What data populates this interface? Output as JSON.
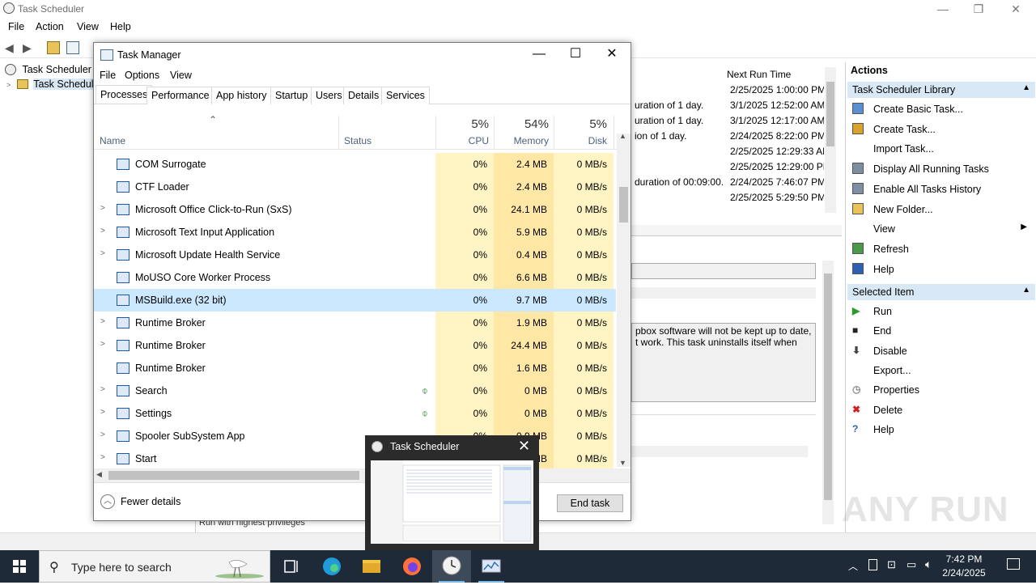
{
  "ts": {
    "title": "Task Scheduler",
    "menu": [
      "File",
      "Action",
      "View",
      "Help"
    ],
    "tree": {
      "root": "Task Scheduler (L",
      "child": "Task Schedule"
    },
    "next_run_header": "Next Run Time",
    "task_lines": [
      {
        "trigger": "",
        "next": "2/25/2025 1:00:00 PM"
      },
      {
        "trigger": "uration of 1 day.",
        "next": "3/1/2025 12:52:00 AM"
      },
      {
        "trigger": "uration of 1 day.",
        "next": "3/1/2025 12:17:00 AM"
      },
      {
        "trigger": "ion of 1 day.",
        "next": "2/24/2025 8:22:00 PM"
      },
      {
        "trigger": "",
        "next": "2/25/2025 12:29:33 AM"
      },
      {
        "trigger": "",
        "next": "2/25/2025 12:29:00 PM"
      },
      {
        "trigger": "duration of 00:09:00.",
        "next": "2/24/2025 7:46:07 PM"
      },
      {
        "trigger": "",
        "next": "2/25/2025 5:29:50 PM"
      }
    ],
    "desc_line1": "pbox software will not be kept up to date,",
    "desc_line2": "t work. This task uninstalls itself when",
    "bottom_text": "Run with highest privileges",
    "actions": {
      "header": "Actions",
      "section1": "Task Scheduler Library",
      "section1_items": [
        "Create Basic Task...",
        "Create Task...",
        "Import Task...",
        "Display All Running Tasks",
        "Enable All Tasks History",
        "New Folder...",
        "View",
        "Refresh",
        "Help"
      ],
      "section2": "Selected Item",
      "section2_items": [
        "Run",
        "End",
        "Disable",
        "Export...",
        "Properties",
        "Delete",
        "Help"
      ]
    }
  },
  "tm": {
    "title": "Task Manager",
    "menu": [
      "File",
      "Options",
      "View"
    ],
    "tabs": [
      "Processes",
      "Performance",
      "App history",
      "Startup",
      "Users",
      "Details",
      "Services"
    ],
    "columns": {
      "name": "Name",
      "status": "Status",
      "cpu_pct": "5%",
      "cpu": "CPU",
      "mem_pct": "54%",
      "mem": "Memory",
      "disk_pct": "5%",
      "disk": "Disk"
    },
    "rows": [
      {
        "name": "COM Surrogate",
        "expand": false,
        "leaf": false,
        "cpu": "0%",
        "mem": "2.4 MB",
        "disk": "0 MB/s"
      },
      {
        "name": "CTF Loader",
        "expand": false,
        "leaf": false,
        "cpu": "0%",
        "mem": "2.4 MB",
        "disk": "0 MB/s"
      },
      {
        "name": "Microsoft Office Click-to-Run (SxS)",
        "expand": true,
        "leaf": false,
        "cpu": "0%",
        "mem": "24.1 MB",
        "disk": "0 MB/s"
      },
      {
        "name": "Microsoft Text Input Application",
        "expand": true,
        "leaf": false,
        "cpu": "0%",
        "mem": "5.9 MB",
        "disk": "0 MB/s"
      },
      {
        "name": "Microsoft Update Health Service",
        "expand": true,
        "leaf": false,
        "cpu": "0%",
        "mem": "0.4 MB",
        "disk": "0 MB/s"
      },
      {
        "name": "MoUSO Core Worker Process",
        "expand": false,
        "leaf": false,
        "cpu": "0%",
        "mem": "6.6 MB",
        "disk": "0 MB/s"
      },
      {
        "name": "MSBuild.exe (32 bit)",
        "expand": false,
        "leaf": false,
        "cpu": "0%",
        "mem": "9.7 MB",
        "disk": "0 MB/s",
        "selected": true
      },
      {
        "name": "Runtime Broker",
        "expand": true,
        "leaf": false,
        "cpu": "0%",
        "mem": "1.9 MB",
        "disk": "0 MB/s"
      },
      {
        "name": "Runtime Broker",
        "expand": true,
        "leaf": false,
        "cpu": "0%",
        "mem": "24.4 MB",
        "disk": "0 MB/s"
      },
      {
        "name": "Runtime Broker",
        "expand": false,
        "leaf": false,
        "cpu": "0%",
        "mem": "1.6 MB",
        "disk": "0 MB/s"
      },
      {
        "name": "Search",
        "expand": true,
        "leaf": true,
        "cpu": "0%",
        "mem": "0 MB",
        "disk": "0 MB/s"
      },
      {
        "name": "Settings",
        "expand": true,
        "leaf": true,
        "cpu": "0%",
        "mem": "0 MB",
        "disk": "0 MB/s"
      },
      {
        "name": "Spooler SubSystem App",
        "expand": true,
        "leaf": false,
        "cpu": "0%",
        "mem": "0.9 MB",
        "disk": "0 MB/s"
      },
      {
        "name": "Start",
        "expand": true,
        "leaf": false,
        "cpu": "0%",
        "mem": "10.1 MB",
        "disk": "0 MB/s"
      }
    ],
    "fewer_details": "Fewer details",
    "end_task": "End task"
  },
  "thumb": {
    "title": "Task Scheduler"
  },
  "taskbar": {
    "search_placeholder": "Type here to search",
    "time": "7:42 PM",
    "date": "2/24/2025"
  },
  "watermark": "ANY RUN",
  "colors": {
    "taskbar": "#1e2a38",
    "selection": "#cce8ff",
    "cpu_heat": "#fff4c4",
    "mem_heat": "#ffe8a6"
  }
}
